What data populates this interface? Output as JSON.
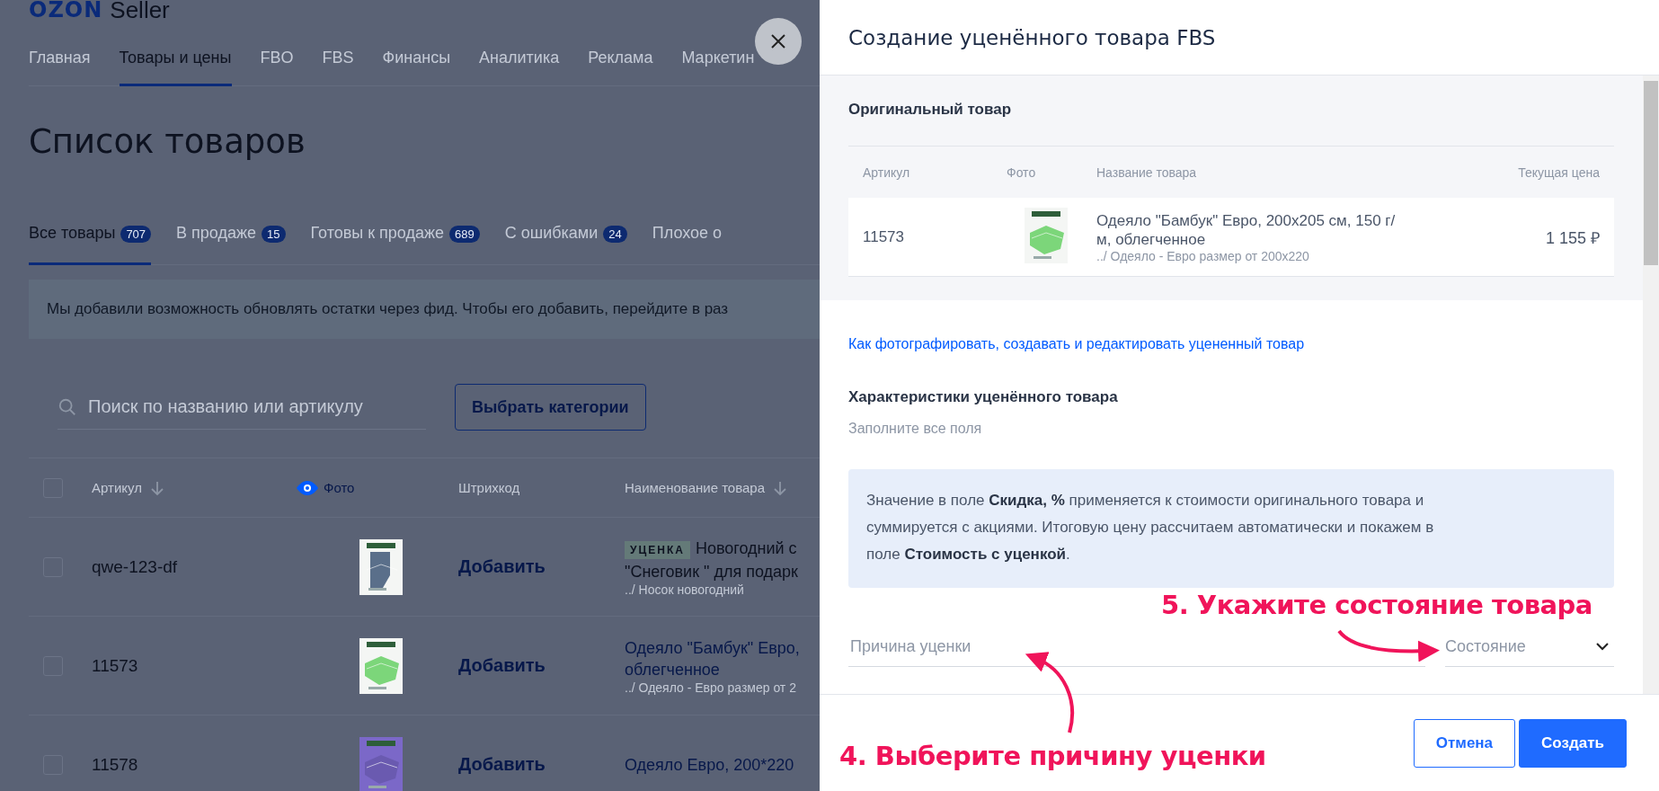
{
  "page": {
    "logo_brand": "OZON",
    "logo_text": "Seller",
    "nav": [
      {
        "label": "Главная",
        "selected": false
      },
      {
        "label": "Товары и цены",
        "selected": true
      },
      {
        "label": "FBO",
        "selected": false
      },
      {
        "label": "FBS",
        "selected": false
      },
      {
        "label": "Финансы",
        "selected": false
      },
      {
        "label": "Аналитика",
        "selected": false
      },
      {
        "label": "Реклама",
        "selected": false
      },
      {
        "label": "Маркетин",
        "selected": false
      }
    ],
    "title": "Список товаров",
    "tabs": [
      {
        "label": "Все товары",
        "count": "707",
        "selected": true
      },
      {
        "label": "В продаже",
        "count": "15",
        "selected": false
      },
      {
        "label": "Готовы к продаже",
        "count": "689",
        "selected": false
      },
      {
        "label": "С ошибками",
        "count": "24",
        "selected": false
      },
      {
        "label": "Плохое о",
        "selected": false
      }
    ],
    "banner": "Мы добавили возможность обновлять остатки через фид. Чтобы его добавить, перейдите в раз",
    "search": {
      "placeholder": "Поиск по названию или артикулу"
    },
    "category_button": "Выбрать категории",
    "table": {
      "select_all": {
        "checked": false
      },
      "columns": [
        "Артикул",
        "Фото",
        "Штрихкод",
        "Наименование товара"
      ],
      "rows": [
        {
          "article": "qwe-123-df",
          "barcode": "Добавить",
          "tag": "УЦЕНКА",
          "name_lines": [
            "Новогодний с",
            "\"Снеговик \" для подарк"
          ],
          "category": "../ Носок новогодний",
          "linked": false,
          "checked": false
        },
        {
          "article": "11573",
          "barcode": "Добавить",
          "name_lines": [
            "Одеяло \"Бамбук\" Евро,",
            "облегченное"
          ],
          "category": "../ Одеяло - Евро размер от 2",
          "linked": true,
          "checked": false
        },
        {
          "article": "11578",
          "barcode": "Добавить",
          "name_lines": [
            "Одеяло Евро, 200*220"
          ],
          "linked": true,
          "checked": false
        }
      ]
    }
  },
  "modal": {
    "title": "Создание уценённого товара FBS",
    "original": {
      "heading": "Оригинальный товар",
      "columns": [
        "Артикул",
        "Фото",
        "Название товара",
        "Текущая цена"
      ],
      "row": {
        "article": "11573",
        "name": "Одеяло \"Бамбук\" Евро, 200x205 см, 150 г/м, облегченное",
        "category": "../ Одеяло - Евро размер от 200x220",
        "price": "1 155 ₽"
      }
    },
    "link": "Как фотографировать, создавать и редактировать уцененный товар",
    "heading": "Характеристики уценённого товара",
    "subtitle": "Заполните все поля",
    "info": "Значение в поле **Скидка, %** применяется к стоимости оригинального товара и суммируется с акциями. Итоговую цену рассчитаем автоматически и покажем в поле **Стоимость с уценкой**.",
    "fields": [
      {
        "kind": "text",
        "placeholder": "Причина уценки"
      },
      {
        "kind": "select",
        "placeholder": "Состояние"
      }
    ],
    "buttons": [
      {
        "label": "Отмена",
        "kind": "secondary"
      },
      {
        "label": "Создать",
        "kind": "primary"
      }
    ]
  },
  "annotations": [
    {
      "text": "5. Укажите состояние товара",
      "kind": "upper"
    },
    {
      "text": "4. Выберите причину уценки",
      "kind": "lower"
    }
  ]
}
